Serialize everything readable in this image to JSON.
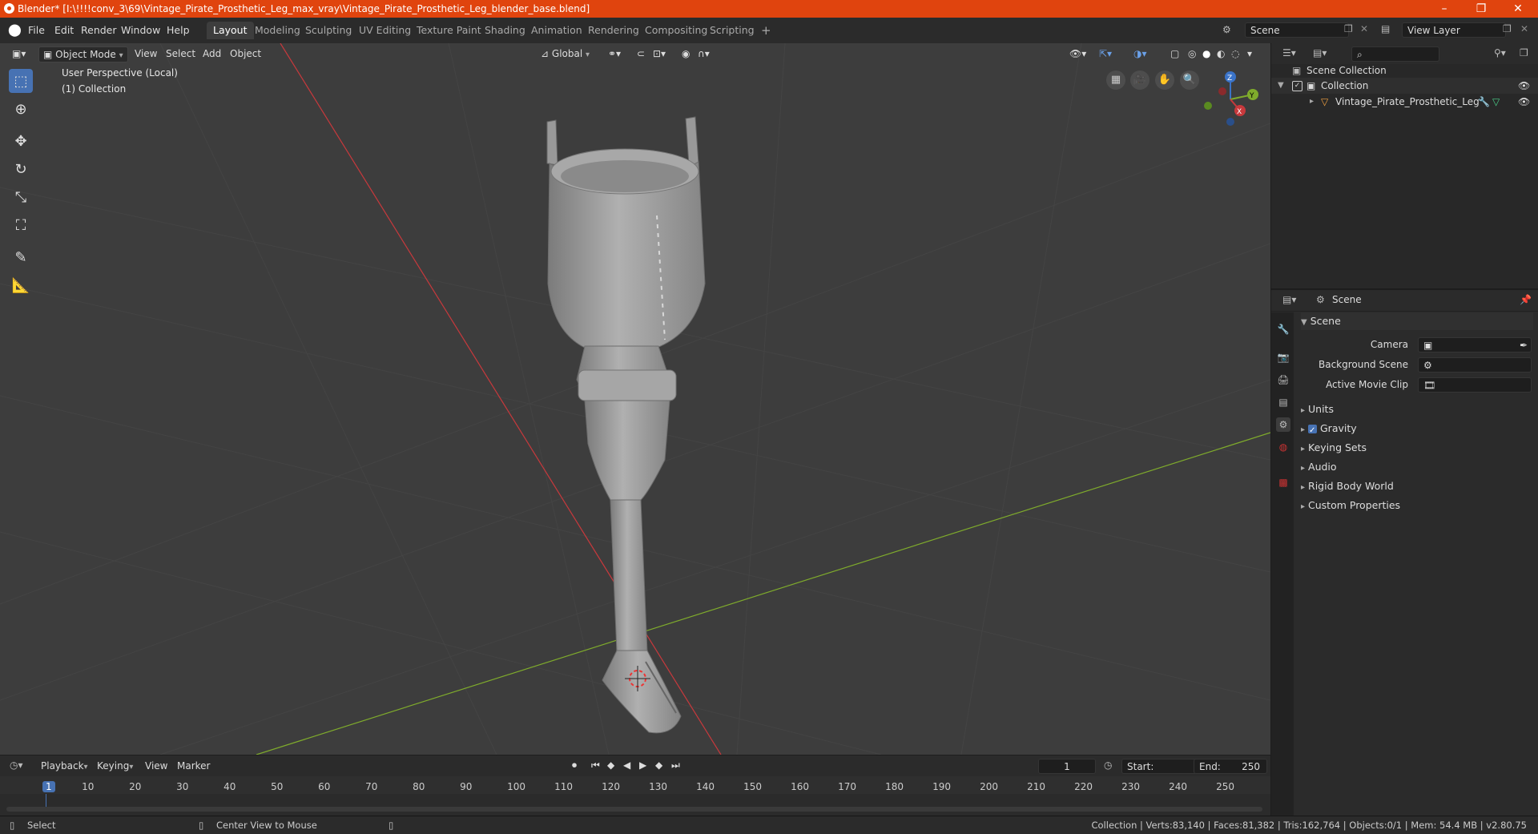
{
  "titlebar": {
    "title": "Blender* [I:\\!!!!conv_3\\69\\Vintage_Pirate_Prosthetic_Leg_max_vray\\Vintage_Pirate_Prosthetic_Leg_blender_base.blend]",
    "minimize": "–",
    "maximize": "❐",
    "close": "✕"
  },
  "menus": [
    "File",
    "Edit",
    "Render",
    "Window",
    "Help"
  ],
  "workspaces": [
    "Layout",
    "Modeling",
    "Sculpting",
    "UV Editing",
    "Texture Paint",
    "Shading",
    "Animation",
    "Rendering",
    "Compositing",
    "Scripting"
  ],
  "workspace_add": "+",
  "scene_field": "Scene",
  "viewlayer_field": "View Layer",
  "viewport": {
    "mode": "Object Mode",
    "menus": [
      "View",
      "Select",
      "Add",
      "Object"
    ],
    "transform_orientation": "Global",
    "overlay_line1": "User Perspective (Local)",
    "overlay_line2": "(1) Collection",
    "gizmo": {
      "x": "X",
      "y": "Y",
      "z": "Z"
    }
  },
  "tools": [
    "select-box-icon",
    "cursor-icon",
    "move-icon",
    "rotate-icon",
    "scale-icon",
    "transform-icon",
    "annotate-icon",
    "measure-icon"
  ],
  "outliner": {
    "root": "Scene Collection",
    "collection": "Collection",
    "object": "Vintage_Pirate_Prosthetic_Leg"
  },
  "properties": {
    "header": "Scene",
    "panel": "Scene",
    "camera_label": "Camera",
    "bg_scene_label": "Background Scene",
    "movie_clip_label": "Active Movie Clip",
    "subpanels": [
      "Units",
      "Gravity",
      "Keying Sets",
      "Audio",
      "Rigid Body World",
      "Custom Properties"
    ]
  },
  "timeline": {
    "menus": [
      "Playback",
      "Keying",
      "View",
      "Marker"
    ],
    "current_frame": "1",
    "start_label": "Start:",
    "start": "1",
    "end_label": "End:",
    "end": "250",
    "ticks": [
      "1",
      "10",
      "20",
      "30",
      "40",
      "50",
      "60",
      "70",
      "80",
      "90",
      "100",
      "110",
      "120",
      "130",
      "140",
      "150",
      "160",
      "170",
      "180",
      "190",
      "200",
      "210",
      "220",
      "230",
      "240",
      "250"
    ]
  },
  "statusbar": {
    "left1": "Select",
    "left2": "Center View to Mouse",
    "stats": "Collection | Verts:83,140 | Faces:81,382 | Tris:162,764 | Objects:0/1 | Mem: 54.4 MB | v2.80.75"
  },
  "colors": {
    "accent": "#4772b3",
    "titlebar": "#e0440e",
    "x_axis": "#c8393c",
    "y_axis": "#7fab2c"
  }
}
